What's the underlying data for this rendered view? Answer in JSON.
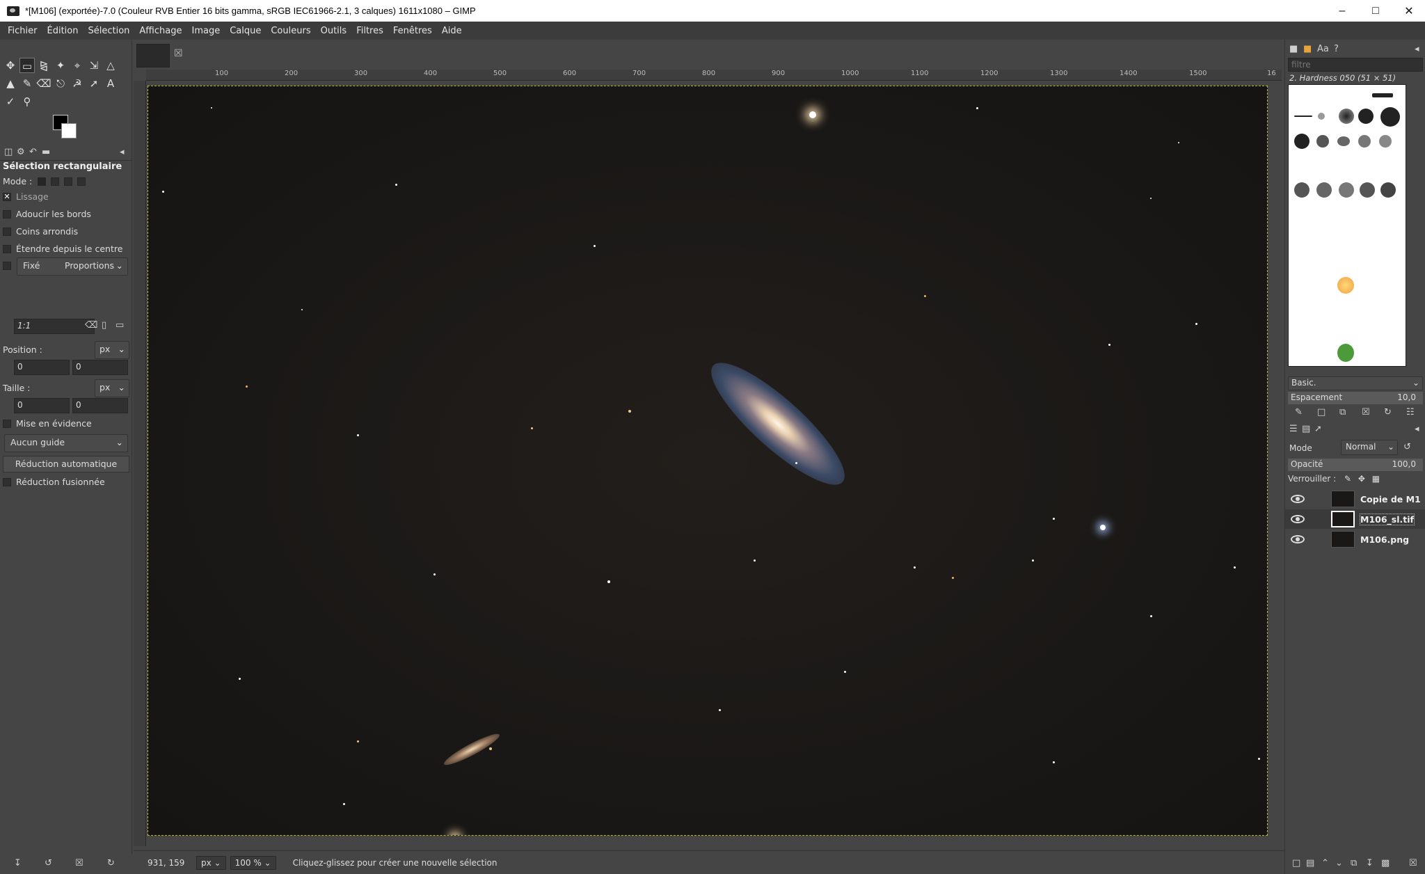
{
  "window": {
    "title": "*[M106] (exportée)-7.0 (Couleur RVB Entier 16 bits gamma, sRGB IEC61966-2.1, 3 calques) 1611x1080 – GIMP"
  },
  "menu": [
    "Fichier",
    "Édition",
    "Sélection",
    "Affichage",
    "Image",
    "Calque",
    "Couleurs",
    "Outils",
    "Filtres",
    "Fenêtres",
    "Aide"
  ],
  "tool_options": {
    "title": "Sélection rectangulaire",
    "mode_label": "Mode :",
    "antialias_label": "Lissage",
    "feather_label": "Adoucir les bords",
    "rounded_label": "Coins arrondis",
    "expand_label": "Étendre depuis le centre",
    "fixed_label": "Fixé",
    "fixed_value": "Proportions",
    "ratio_value": "1:1",
    "position_label": "Position :",
    "position_unit": "px",
    "position_x": "0",
    "position_y": "0",
    "size_label": "Taille :",
    "size_unit": "px",
    "size_w": "0",
    "size_h": "0",
    "highlight_label": "Mise en évidence",
    "guide_value": "Aucun guide",
    "auto_shrink_label": "Réduction automatique",
    "merged_label": "Réduction fusionnée"
  },
  "ruler": {
    "labels": [
      "100",
      "200",
      "300",
      "400",
      "500",
      "600",
      "700",
      "800",
      "900",
      "1000",
      "1100",
      "1200",
      "1300",
      "1400",
      "1500",
      "16"
    ]
  },
  "status": {
    "coords": "931, 159",
    "unit": "px",
    "zoom": "100 %",
    "message": "Cliquez-glissez pour créer une nouvelle sélection"
  },
  "brushes": {
    "filter_placeholder": "filtre",
    "current": "2. Hardness 050 (51 × 51)",
    "set": "Basic.",
    "spacing_label": "Espacement",
    "spacing_value": "10,0"
  },
  "layers": {
    "mode_label": "Mode",
    "mode_value": "Normal",
    "opacity_label": "Opacité",
    "opacity_value": "100,0",
    "lock_label": "Verrouiller :",
    "items": [
      {
        "name": "Copie de M1"
      },
      {
        "name": "M106_sl.tif"
      },
      {
        "name": "M106.png"
      }
    ]
  }
}
